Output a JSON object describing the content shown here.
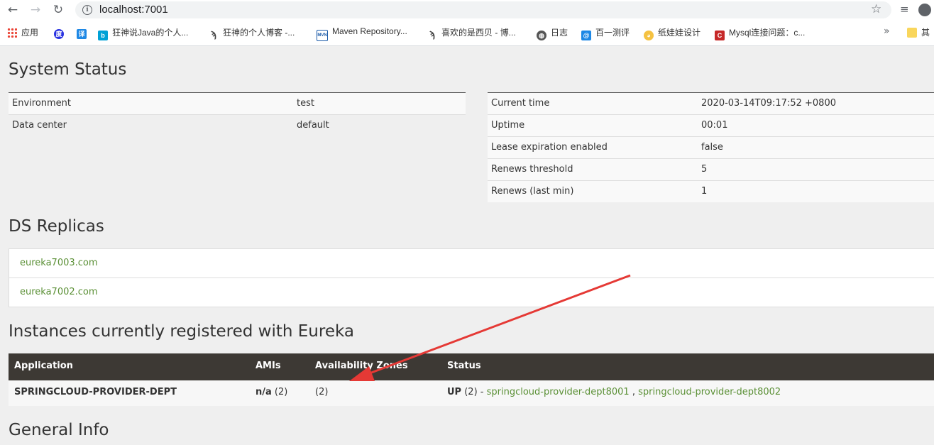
{
  "browser": {
    "url": "localhost:7001",
    "bookmarks": [
      {
        "label": "应用",
        "icon": "apps-grid-icon"
      },
      {
        "label": "",
        "icon": "baidu-paw-icon"
      },
      {
        "label": "",
        "icon": "translate-icon"
      },
      {
        "label": "狂神说Java的个人...",
        "icon": "bilibili-icon"
      },
      {
        "label": "狂神的个人博客 -...",
        "icon": "yuque-icon"
      },
      {
        "label": "Maven Repository...",
        "icon": "mvn-icon"
      },
      {
        "label": "喜欢的是西贝 - 博...",
        "icon": "yuque-icon"
      },
      {
        "label": "日志",
        "icon": "globe-icon"
      },
      {
        "label": "百一测评",
        "icon": "exam-icon"
      },
      {
        "label": "纸娃娃设计",
        "icon": "doll-icon"
      },
      {
        "label": "Mysql连接问题：c...",
        "icon": "csdn-icon"
      },
      {
        "label": "其",
        "icon": "folder-icon"
      }
    ],
    "more_label": "»"
  },
  "system_status": {
    "title": "System Status",
    "left": [
      {
        "key": "Environment",
        "value": "test"
      },
      {
        "key": "Data center",
        "value": "default"
      }
    ],
    "right": [
      {
        "key": "Current time",
        "value": "2020-03-14T09:17:52 +0800"
      },
      {
        "key": "Uptime",
        "value": "00:01"
      },
      {
        "key": "Lease expiration enabled",
        "value": "false"
      },
      {
        "key": "Renews threshold",
        "value": "5"
      },
      {
        "key": "Renews (last min)",
        "value": "1"
      }
    ]
  },
  "ds_replicas": {
    "title": "DS Replicas",
    "items": [
      "eureka7003.com",
      "eureka7002.com"
    ]
  },
  "instances": {
    "title": "Instances currently registered with Eureka",
    "headers": [
      "Application",
      "AMIs",
      "Availability Zones",
      "Status"
    ],
    "row": {
      "application": "SPRINGCLOUD-PROVIDER-DEPT",
      "amis_bold": "n/a",
      "amis_count": " (2)",
      "zones": "(2)",
      "status_bold": "UP",
      "status_count": " (2) - ",
      "link1": "springcloud-provider-dept8001",
      "separator": " , ",
      "link2": "springcloud-provider-dept8002"
    }
  },
  "general_info": {
    "title": "General Info"
  },
  "colors": {
    "link": "#5b9036",
    "header_bg": "#3d3934",
    "annotation_arrow": "#e53935"
  }
}
